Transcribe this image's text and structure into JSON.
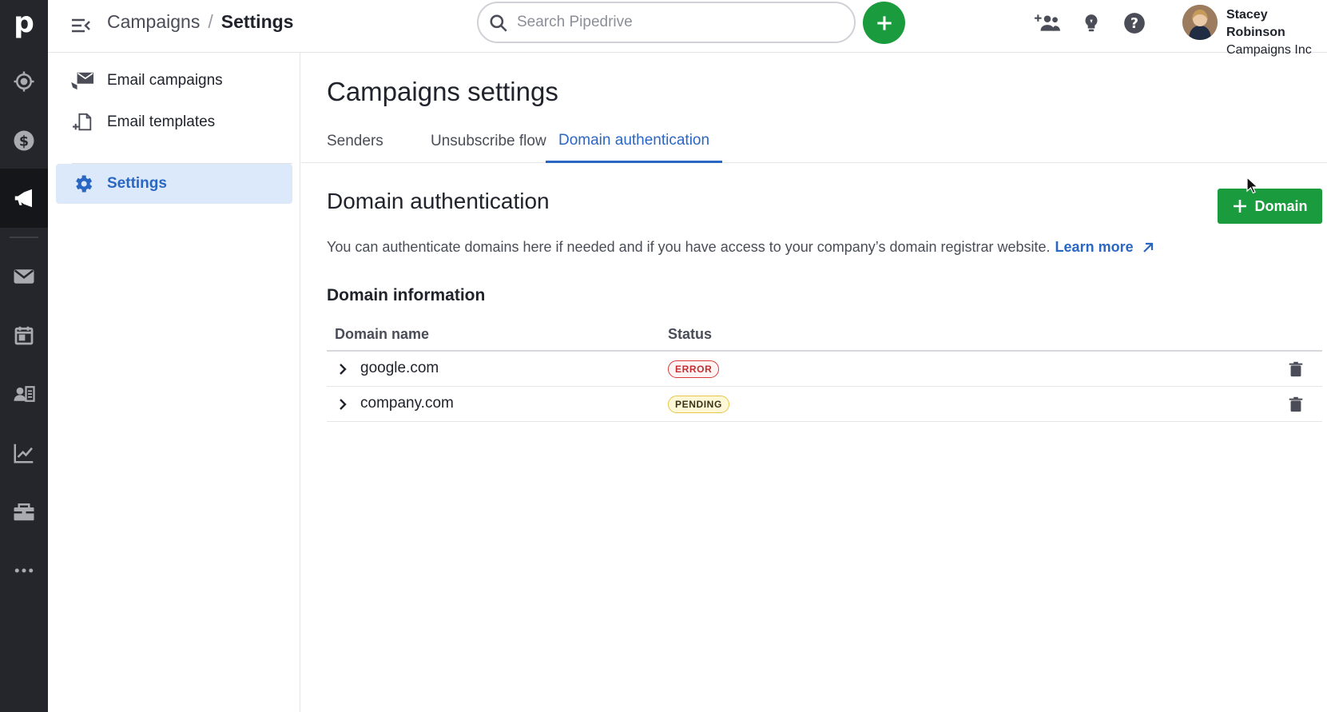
{
  "rail": {
    "logo": "p",
    "items": [
      {
        "icon": "target-icon"
      },
      {
        "icon": "dollar-icon"
      },
      {
        "icon": "megaphone-icon",
        "active": true
      },
      {
        "icon": "mail-icon"
      },
      {
        "icon": "calendar-icon"
      },
      {
        "icon": "contacts-icon"
      },
      {
        "icon": "chart-icon"
      },
      {
        "icon": "products-icon"
      },
      {
        "icon": "more-icon"
      }
    ]
  },
  "topbar": {
    "breadcrumb_parent": "Campaigns",
    "breadcrumb_separator": "/",
    "breadcrumb_current": "Settings",
    "search_placeholder": "Search Pipedrive",
    "user_name": "Stacey Robinson",
    "company": "Campaigns Inc"
  },
  "subnav": {
    "items": [
      {
        "label": "Email campaigns",
        "icon": "email-campaigns-icon"
      },
      {
        "label": "Email templates",
        "icon": "email-templates-icon"
      },
      {
        "label": "Settings",
        "icon": "gear-icon",
        "active": true
      }
    ]
  },
  "main": {
    "title": "Campaigns settings",
    "tabs": [
      {
        "label": "Senders"
      },
      {
        "label": "Unsubscribe flow"
      },
      {
        "label": "Domain authentication",
        "active": true
      }
    ],
    "section_title": "Domain authentication",
    "add_button_label": "Domain",
    "description": "You can authenticate domains here if needed and if you have access to your company’s domain registrar website.",
    "learn_more": "Learn more",
    "info_title": "Domain information",
    "table": {
      "headers": [
        "Domain name",
        "Status"
      ],
      "rows": [
        {
          "domain": "google.com",
          "status": "ERROR"
        },
        {
          "domain": "company.com",
          "status": "PENDING"
        }
      ]
    }
  },
  "colors": {
    "rail_bg": "#25262b",
    "accent_green": "#1a9c3e",
    "link_blue": "#2a67c3",
    "active_nav_bg": "#dce9fb",
    "error_red": "#d9383b",
    "pending_yellow": "#e6c54a"
  }
}
